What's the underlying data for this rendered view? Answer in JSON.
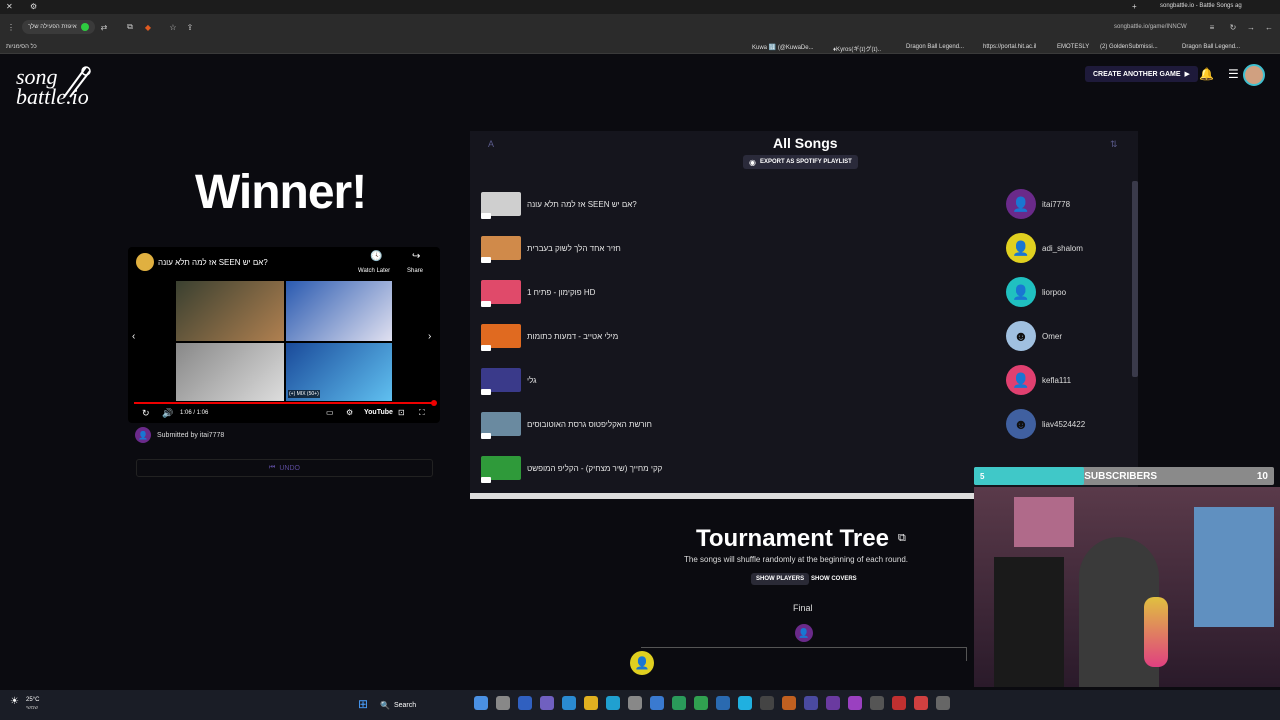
{
  "browser": {
    "url": "songbattle.io/game/INNCW",
    "tab_title": "songbattle.io - Battle Songs ag",
    "left_ext": "איגוזת הפעילה שלך",
    "bookmark_folder": "כל הסימניות",
    "bookmarks": [
      "Kuwa 🔢 (@KuwaDe...",
      "♦Kyros(ギ(ɪ)グ(ɪ)..",
      "Dragon Ball Legend...",
      "https://portal.hit.ac.il",
      "EMOTESLY",
      "(2) GoldenSubmissi...",
      "Dragon Ball Legend..."
    ]
  },
  "header": {
    "logo_line1": "song",
    "logo_line2": "battle.io",
    "create_game_label": "CREATE ANOTHER GAME"
  },
  "winner": {
    "title": "Winner!",
    "video_title": "אז למה תלא עונה SEEN אם יש?",
    "watch_later": "Watch Later",
    "share": "Share",
    "time": "1:06 / 1:06",
    "mix_label": "(+) MIX (50+)",
    "youtube_label": "YouTube",
    "submitted_by": "Submitted by itai7778",
    "undo_label": "UNDO"
  },
  "all_songs": {
    "title": "All Songs",
    "export_label": "EXPORT AS SPOTIFY PLAYLIST",
    "songs": [
      {
        "title": "אז למה תלא עונה SEEN אם יש?",
        "color": "#cfcfcf"
      },
      {
        "title": "חזיר אחד הלך לשוק בעברית",
        "color": "#d08a4a"
      },
      {
        "title": "פוקימון - פתיח 1 HD",
        "color": "#e04a6a"
      },
      {
        "title": "מילי אטייב - דמעות כתומות",
        "color": "#e06a20"
      },
      {
        "title": "גלי",
        "color": "#3a3a8a"
      },
      {
        "title": "חורשת האקליפטוס גרסת האוטובוסים",
        "color": "#6a8aa0"
      },
      {
        "title": "קקי מחייך (שיר מצחיק) - הקליפ המופשט",
        "color": "#2f9a3a"
      }
    ],
    "players": [
      {
        "name": "itai7778",
        "color": "#6a2a8a"
      },
      {
        "name": "adi_shalom",
        "color": "#e0d020"
      },
      {
        "name": "liorpoo",
        "color": "#20c0c0"
      },
      {
        "name": "Omer",
        "color": "#a0c0e0"
      },
      {
        "name": "kefla111",
        "color": "#e04070"
      },
      {
        "name": "liav4524422",
        "color": "#4060a0"
      }
    ]
  },
  "tournament": {
    "title": "Tournament Tree",
    "subtitle": "The songs will shuffle randomly at the beginning of each round.",
    "show_players": "SHOW PLAYERS",
    "show_covers": "SHOW COVERS",
    "final_label": "Final"
  },
  "stream": {
    "subs_left": "5",
    "subs_label": "SUBSCRIBERS",
    "subs_right": "10"
  },
  "taskbar": {
    "weather": "25°C",
    "weather_sub": "שמשי",
    "search": "Search"
  }
}
